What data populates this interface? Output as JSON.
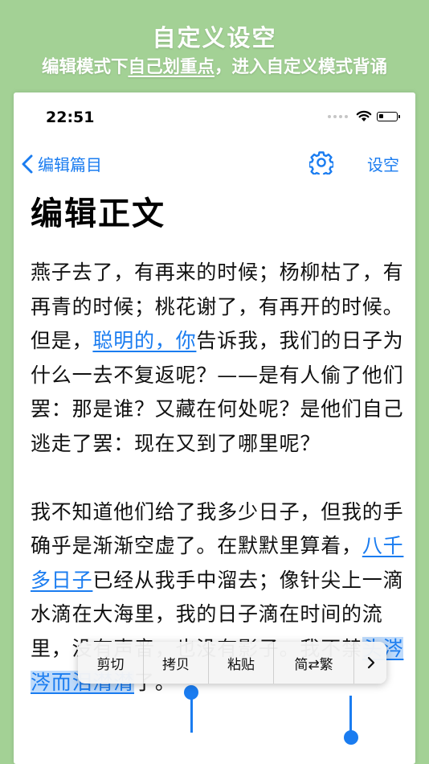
{
  "promo": {
    "title": "自定义设空",
    "subtitle_pre": "编辑模式下",
    "subtitle_highlight": "自己划重点",
    "subtitle_post": "，进入自定义模式背诵"
  },
  "status_bar": {
    "time": "22:51"
  },
  "nav": {
    "back_label": "编辑篇目",
    "done_label": "设空"
  },
  "page_title": "编辑正文",
  "paragraph1": {
    "a": "燕子去了，有再来的时候；杨柳枯了，有再青的时候；桃花谢了，有再开的时候。但是，",
    "mark": "聪明的，你",
    "b": "告诉我，我们的日子为什么一去不复返呢？——是有人偷了他们罢：那是谁？又藏在何处呢？是他们自己逃走了罢：现在又到了哪里呢？"
  },
  "paragraph2": {
    "a": "我不知道他们给了我多少日子，但我的手确乎是渐渐空虚了。在默默里算着，",
    "mark": "八千多日子",
    "b": "已经从我手中溜去；像针尖上一滴水滴在大海里，我的日子滴在时间的流里，没有声音，也没有影子。我不禁",
    "selected": "头涔涔而泪潸潸",
    "c": "了。"
  },
  "context_menu": {
    "items": [
      "剪切",
      "拷贝",
      "粘贴",
      "简⇄繁"
    ],
    "more_icon": "chevron-right-icon"
  },
  "colors": {
    "background": "#a3d195",
    "accent": "#1a7cf0"
  }
}
